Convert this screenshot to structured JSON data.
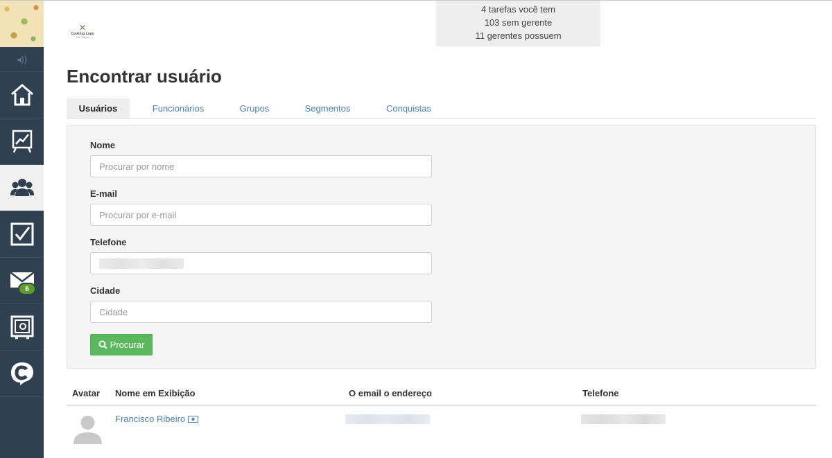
{
  "stats": {
    "line1": "4 tarefas você tem",
    "line2": "103 sem gerente",
    "line3": "11 gerentes possuem"
  },
  "logo": {
    "text": "Cooking Logo",
    "sub": "Your Tagline"
  },
  "page_title": "Encontrar usuário",
  "tabs": [
    {
      "label": "Usuários",
      "active": true
    },
    {
      "label": "Funcionários",
      "active": false
    },
    {
      "label": "Grupos",
      "active": false
    },
    {
      "label": "Segmentos",
      "active": false
    },
    {
      "label": "Conquistas",
      "active": false
    }
  ],
  "sidebar": {
    "items": [
      {
        "icon": "home-icon"
      },
      {
        "icon": "chart-board-icon"
      },
      {
        "icon": "users-icon",
        "active": true
      },
      {
        "icon": "checkbox-icon"
      },
      {
        "icon": "mail-icon",
        "badge": "6"
      },
      {
        "icon": "safe-icon"
      },
      {
        "icon": "chat-c-icon"
      }
    ]
  },
  "form": {
    "name_label": "Nome",
    "name_placeholder": "Procurar por nome",
    "email_label": "E-mail",
    "email_placeholder": "Procurar por e-mail",
    "phone_label": "Telefone",
    "city_label": "Cidade",
    "city_placeholder": "Cidade",
    "search_button": "Procurar"
  },
  "table": {
    "columns": [
      "Avatar",
      "Nome em Exibição",
      "O email o endereço",
      "Telefone"
    ],
    "rows": [
      {
        "name": "Francisco Ribeiro"
      }
    ]
  },
  "colors": {
    "sidebar_bg": "#2f4050",
    "link": "#4a7fb5",
    "button_green": "#5cb85c",
    "badge_green": "#5d9c2a"
  }
}
